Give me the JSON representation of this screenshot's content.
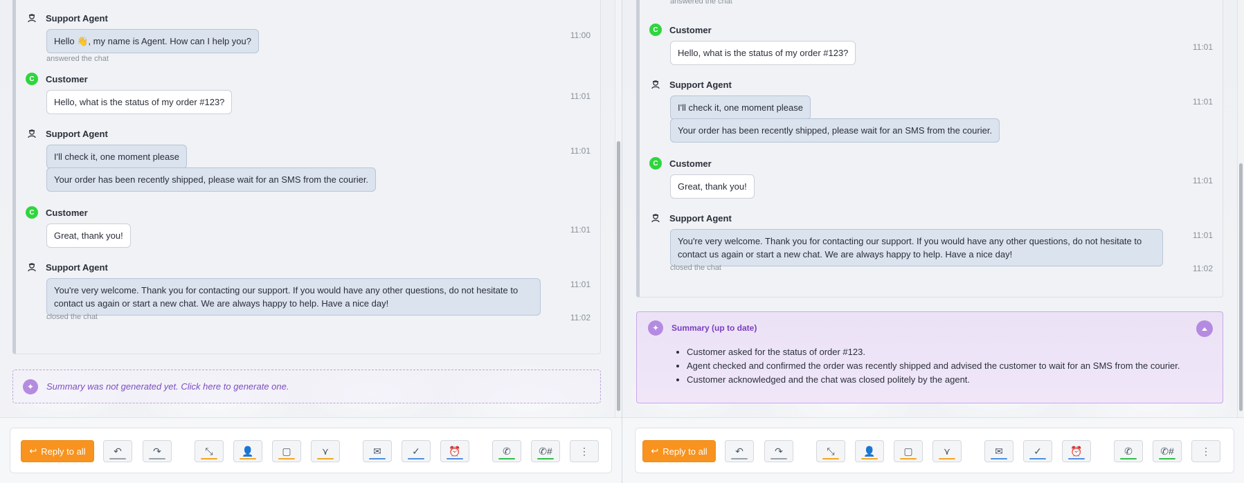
{
  "panes": {
    "left": {
      "messages": [
        {
          "who": "Support Agent",
          "kind": "agent",
          "bubbles": [
            "Hello 👋, my name is Agent. How can I help you?"
          ],
          "time": "11:00",
          "note": "answered the chat"
        },
        {
          "who": "Customer",
          "kind": "cust",
          "bubbles": [
            "Hello, what is the status of my order #123?"
          ],
          "time": "11:01"
        },
        {
          "who": "Support Agent",
          "kind": "agent",
          "bubbles": [
            "I'll check it, one moment please",
            "Your order has been recently shipped, please wait for an SMS from the courier."
          ],
          "time": "11:01"
        },
        {
          "who": "Customer",
          "kind": "cust",
          "bubbles": [
            "Great, thank you!"
          ],
          "time": "11:01"
        },
        {
          "who": "Support Agent",
          "kind": "agent",
          "bubbles": [
            "You're very welcome. Thank you for contacting our support. If you would have any other questions, do not hesitate to contact us again or start a new chat. We are always happy to help. Have a nice day!"
          ],
          "time": "11:01",
          "note": "closed the chat",
          "note_time": "11:02"
        }
      ],
      "summary_prompt": "Summary was not generated yet. Click here to generate one."
    },
    "right": {
      "top_note": "answered the chat",
      "messages": [
        {
          "who": "Customer",
          "kind": "cust",
          "bubbles": [
            "Hello, what is the status of my order #123?"
          ],
          "time": "11:01"
        },
        {
          "who": "Support Agent",
          "kind": "agent",
          "bubbles": [
            "I'll check it, one moment please",
            "Your order has been recently shipped, please wait for an SMS from the courier."
          ],
          "time": "11:01"
        },
        {
          "who": "Customer",
          "kind": "cust",
          "bubbles": [
            "Great, thank you!"
          ],
          "time": "11:01"
        },
        {
          "who": "Support Agent",
          "kind": "agent",
          "bubbles": [
            "You're very welcome. Thank you for contacting our support. If you would have any other questions, do not hesitate to contact us again or start a new chat. We are always happy to help. Have a nice day!"
          ],
          "time": "11:01",
          "note": "closed the chat",
          "note_time": "11:02"
        }
      ],
      "summary": {
        "title": "Summary (up to date)",
        "points": [
          "Customer asked for the status of order #123.",
          "Agent checked and confirmed the order was recently shipped and advised the customer to wait for an SMS from the courier.",
          "Customer acknowledged and the chat was closed politely by the agent."
        ]
      }
    }
  },
  "toolbar": {
    "reply_all_label": "Reply to all",
    "icons": [
      "reply-icon",
      "forward-icon",
      "transfer-icon",
      "add-user-icon",
      "note-icon",
      "merge-icon",
      "mark-unread-icon",
      "resolve-icon",
      "snooze-icon",
      "call-icon",
      "call-number-icon",
      "more-icon"
    ]
  },
  "colors": {
    "accent_orange": "#f7931e",
    "gray_underline": "#9aa0a8",
    "orange_underline": "#f5a623",
    "blue_underline": "#4a90e2",
    "green_underline": "#2fbf4a",
    "customer_avatar": "#2fd53e",
    "summary_purple": "#b48be0"
  }
}
